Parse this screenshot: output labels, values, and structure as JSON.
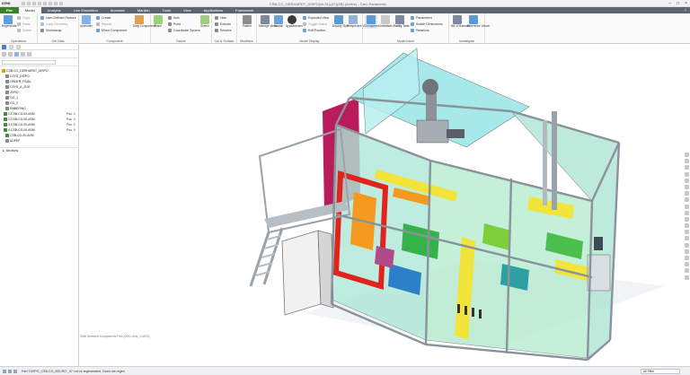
{
  "app": {
    "logo": "creo",
    "title": "CSB-CG_GERHARDT_DISPO(W-SL)(A7)(3B) (Active) - Creo Parametric"
  },
  "tabs": [
    "File",
    "Model",
    "Analysis",
    "Live Simulation",
    "Annotate",
    "Manikin",
    "Tools",
    "View",
    "Applications",
    "Framework"
  ],
  "active_tab": "Model",
  "ribbon": {
    "operations": {
      "label": "Operations",
      "regenerate": "Regenerate",
      "copy": "Copy",
      "paste": "Paste",
      "delete": "Delete"
    },
    "get_data": {
      "label": "Get Data",
      "user_defined": "User-Defined Feature",
      "copy_geom": "Copy Geometry",
      "shrinkwrap": "Shrinkwrap"
    },
    "component": {
      "label": "Component",
      "assemble": "Assemble",
      "create": "Create",
      "repeat": "Repeat",
      "mirror": "Mirror Component",
      "drag": "Drag Components"
    },
    "datum": {
      "label": "Datum",
      "plane": "Plane",
      "axis": "Axis",
      "point": "Point",
      "csys": "Coordinate System",
      "sketch": "Sketch"
    },
    "cut_surface": {
      "label": "Cut & Surface",
      "hole": "Hole",
      "extrude": "Extrude",
      "revolve": "Revolve"
    },
    "modifiers": {
      "label": "Modifiers",
      "pattern": "Pattern"
    },
    "model_display": {
      "label": "Model Display",
      "manage_views": "Manage Views",
      "section": "Section",
      "appearances": "Appearances",
      "exploded": "Exploded View",
      "toggle": "Toggle Status",
      "edit_position": "Edit Position",
      "display_style": "Display Style",
      "perspective": "Perspective View"
    },
    "model_intent": {
      "label": "Model Intent",
      "component_interface": "Component Interface",
      "publish_geometry": "Publish Geometry",
      "family_table": "Family Table",
      "parameters": "Parameters",
      "switch_dimensions": "Switch Dimensions",
      "relations": "Relations"
    },
    "investigate": {
      "label": "Investigate",
      "bom": "Bill of Materials",
      "reference_viewer": "Reference Viewer"
    }
  },
  "tree": {
    "items": [
      {
        "label": "CSB-CG_GERHARDT_DISPO",
        "col2": "",
        "color": "#d9a400"
      },
      {
        "label": "CSYS_DISPO",
        "col2": "",
        "color": "#8a8a8a"
      },
      {
        "label": "ORDER_FINAL",
        "col2": "",
        "color": "#8a8a8a"
      },
      {
        "label": "CSYS_A_ZUG",
        "col2": "",
        "color": "#8a8a8a"
      },
      {
        "label": "ZERO",
        "col2": "",
        "color": "#8a8a8a"
      },
      {
        "label": "OG_1",
        "col2": "",
        "color": "#8a8a8a"
      },
      {
        "label": "OG_2",
        "col2": "",
        "color": "#8a8a8a"
      },
      {
        "label": "RNBERING",
        "col2": "",
        "color": "#8a8a8a"
      },
      {
        "label": "1-CSB-CG-00-ASM",
        "col2": "Pos. 0",
        "color": "#3c8d3c"
      },
      {
        "label": "2-CSB-CG-00-ASM",
        "col2": "Pos. 0",
        "color": "#3c8d3c"
      },
      {
        "label": "3-CSB-CG-00-ASM",
        "col2": "Pos. 0",
        "color": "#3c8d3c"
      },
      {
        "label": "4-CSB-CG-00-ASM",
        "col2": "Pos. 0",
        "color": "#3c8d3c"
      },
      {
        "label": "CSB-CG-00-ASM",
        "col2": "",
        "color": "#3c8d3c"
      },
      {
        "label": "ADPEF",
        "col2": "",
        "color": "#8a8a8a"
      }
    ],
    "sections_label": "Sections"
  },
  "viewport": {
    "caption": "Click Selected Components Pick (0001-Axis_1-MCS)"
  },
  "status": {
    "message": "Part 'DISPO_CSB-CG_000-RG'_47' not re-regenerated. Does not regen",
    "filter": "All Filter"
  },
  "colors": {
    "accent_blue": "#4a7fc1",
    "file_green": "#3f7e2b",
    "tab_bar": "#5d6670",
    "frame_aluminum": "#9aa2aa",
    "guard_cyan": "#7fe0e0",
    "guard_green": "#a8e6a0",
    "yellow": "#f2e43a",
    "red": "#e0241d",
    "orange": "#f59a1f",
    "purple": "#b04a8a"
  }
}
